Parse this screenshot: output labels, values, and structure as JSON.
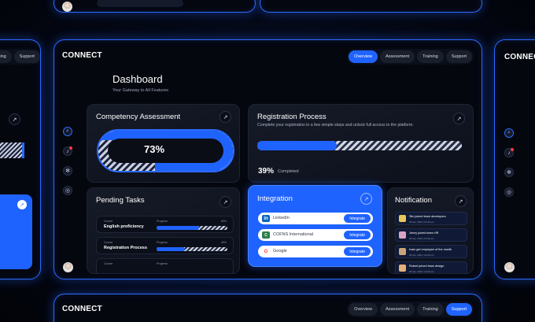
{
  "brand": "CONNECT",
  "nav": [
    "Overview",
    "Assessment",
    "Training",
    "Support"
  ],
  "dashboard": {
    "title": "Dashboard",
    "subtitle": "Your Gateway to All Features"
  },
  "competency": {
    "title": "Competency Assessment",
    "percent_label": "73%",
    "value": 0.73
  },
  "registration": {
    "title": "Registration Process",
    "description": "Complete your registration in a few simple steps and unlock full access to the platform.",
    "percent_label": "39%",
    "status": "Completed",
    "value": 0.39
  },
  "pending": {
    "title": "Pending Tasks",
    "tasks": [
      {
        "label": "Course",
        "name": "English proficiency",
        "progress_label": "Progress",
        "percent": "60%",
        "value": 0.6
      },
      {
        "label": "Course",
        "name": "Registration Process",
        "progress_label": "Progress",
        "percent": "40%",
        "value": 0.4
      },
      {
        "label": "Course",
        "name": "",
        "progress_label": "Progress",
        "percent": "",
        "value": 0.0
      }
    ]
  },
  "integration": {
    "title": "Integration",
    "items": [
      {
        "name": "LinkedIn",
        "icon": "in",
        "button": "Integrate"
      },
      {
        "name": "COFNS International",
        "icon": "C",
        "button": "Integrate"
      },
      {
        "name": "Google",
        "icon": "G",
        "button": "Integrate"
      }
    ]
  },
  "notification": {
    "title": "Notification",
    "items": [
      {
        "title": "Slin joined team developers",
        "date": "06 Apr, 2024 | 04:20 pm"
      },
      {
        "title": "Jenny joined team HR",
        "date": "06 Apr, 2024 | 04:20 pm"
      },
      {
        "title": "Ivam get employee of the month",
        "date": "06 Apr, 2024 | 04:20 pm"
      },
      {
        "title": "Robert joined team design",
        "date": "06 Apr, 2024 | 04:20 pm"
      }
    ]
  },
  "colors": {
    "accent": "#1f63ff",
    "frame": "#2b6bff",
    "background": "#05070f"
  }
}
